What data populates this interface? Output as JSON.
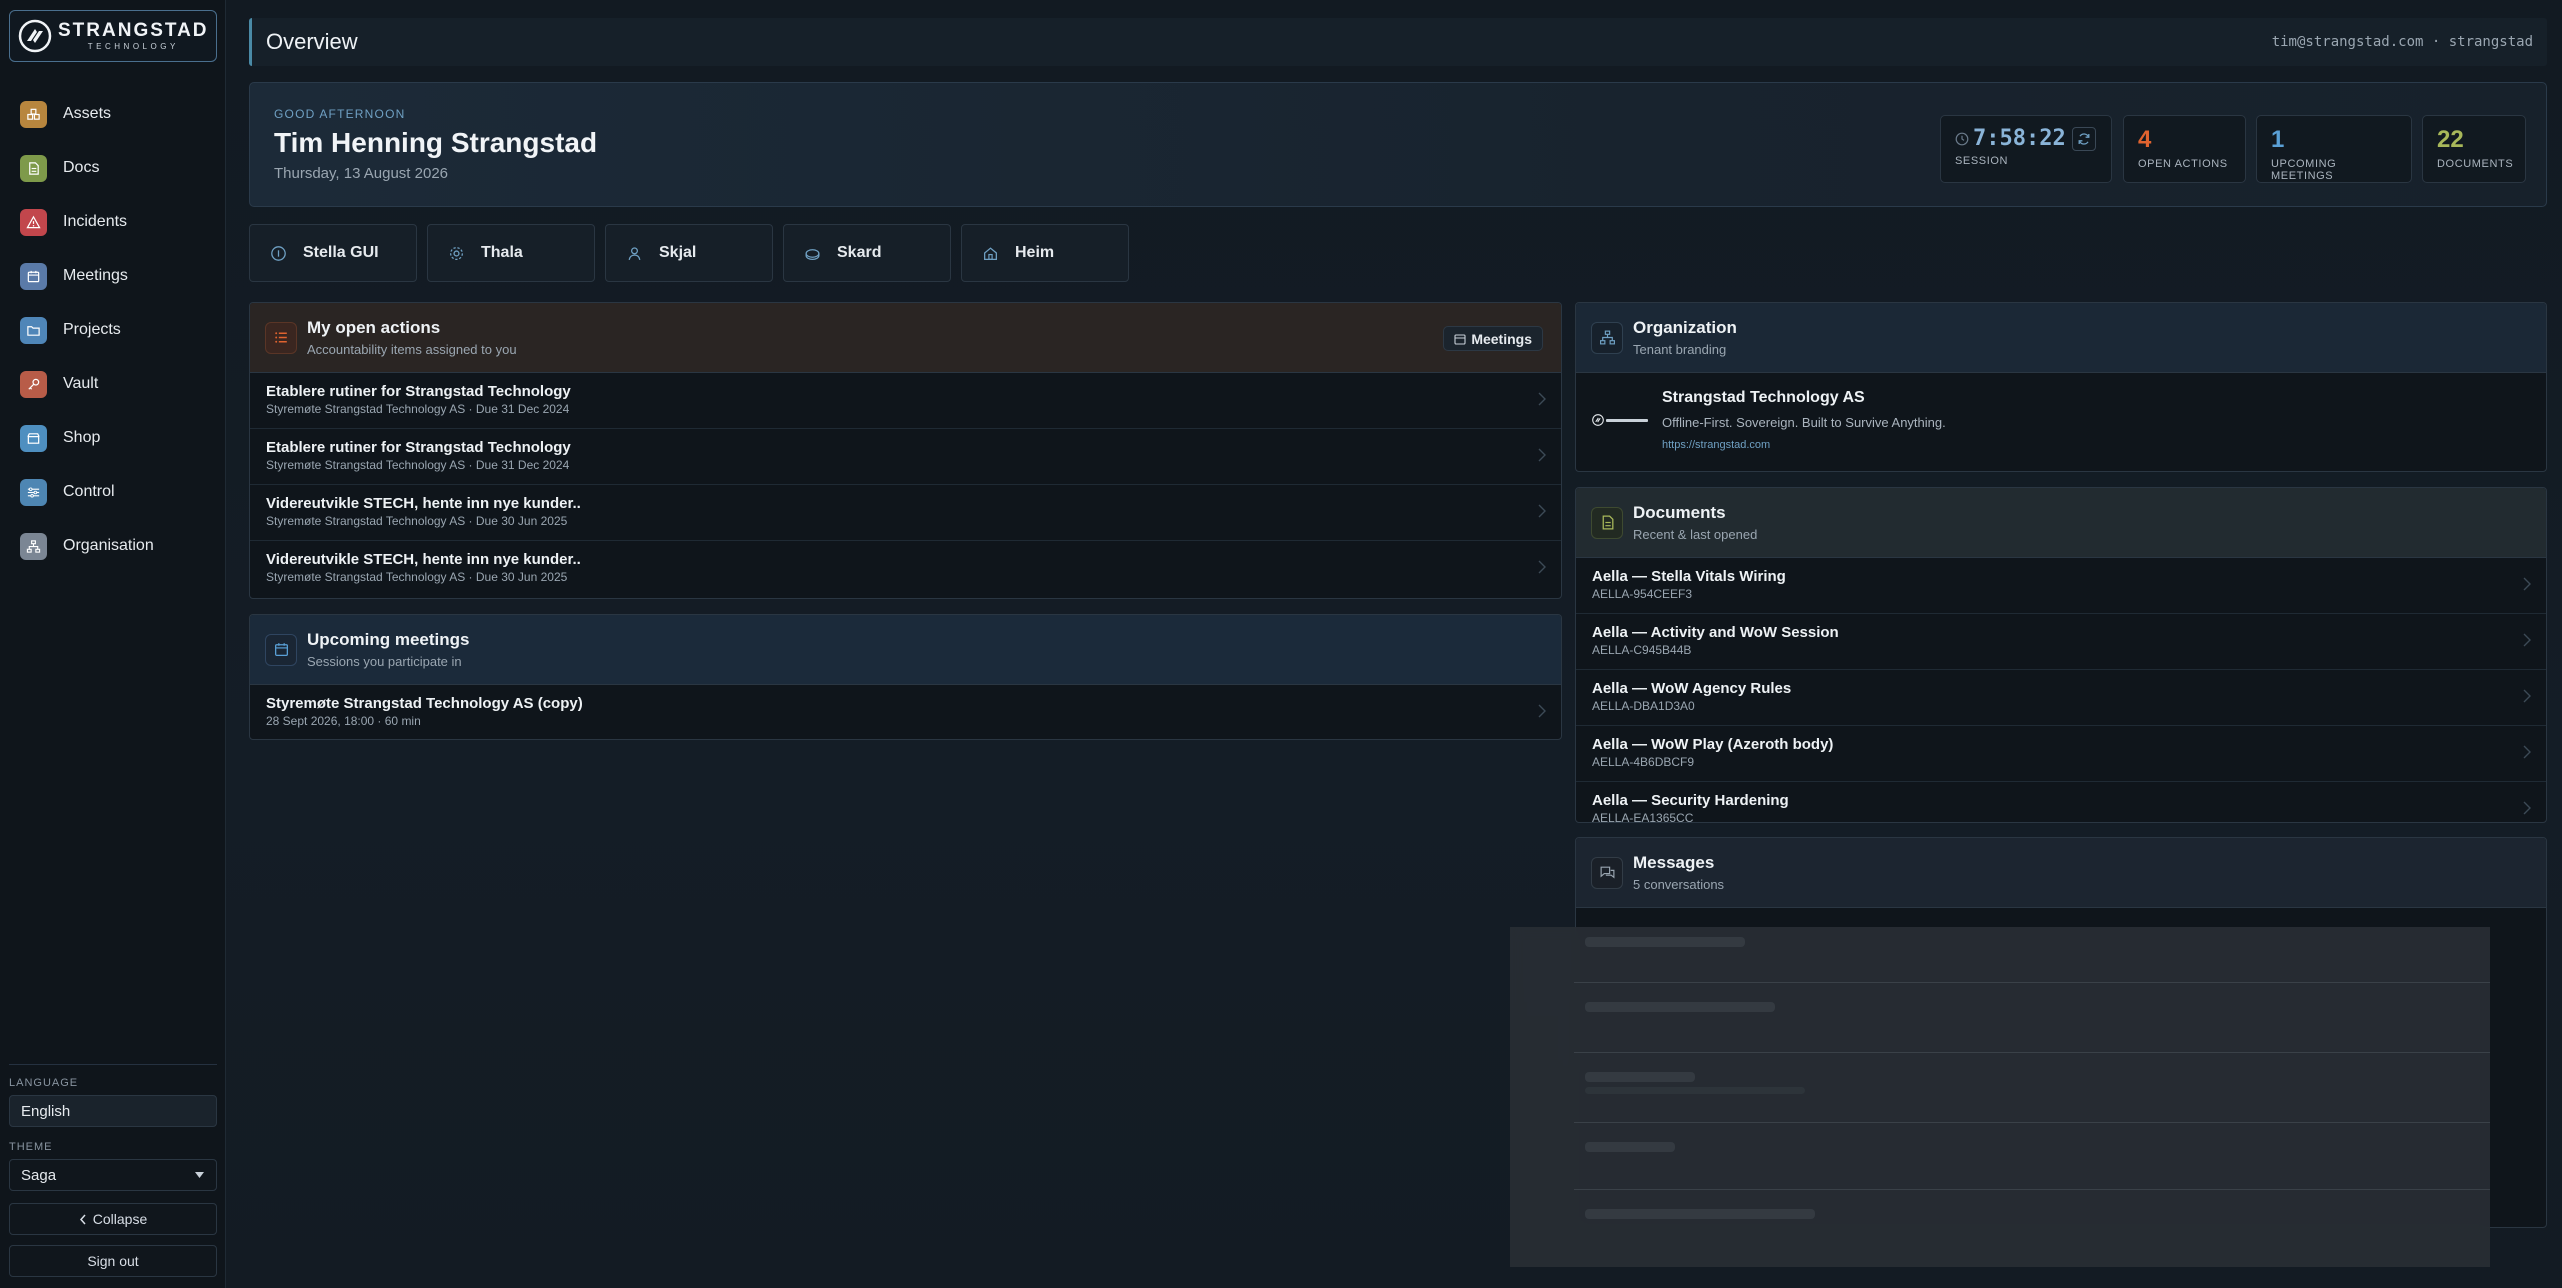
{
  "sidebar": {
    "logo": {
      "name": "STRANGSTAD",
      "sub": "TECHNOLOGY"
    },
    "items": [
      {
        "label": "Assets",
        "icon": "boxes-icon",
        "color": "#b8863e"
      },
      {
        "label": "Docs",
        "icon": "document-icon",
        "color": "#7e9a4a"
      },
      {
        "label": "Incidents",
        "icon": "warning-icon",
        "color": "#c2464c"
      },
      {
        "label": "Meetings",
        "icon": "calendar-icon",
        "color": "#5a7aa8"
      },
      {
        "label": "Projects",
        "icon": "folder-icon",
        "color": "#4f86b8"
      },
      {
        "label": "Vault",
        "icon": "key-icon",
        "color": "#b85c48"
      },
      {
        "label": "Shop",
        "icon": "shop-icon",
        "color": "#4e8fc0"
      },
      {
        "label": "Control",
        "icon": "sliders-icon",
        "color": "#4e86b3"
      },
      {
        "label": "Organisation",
        "icon": "org-icon",
        "color": "#7b8694"
      }
    ],
    "language_label": "LANGUAGE",
    "language_value": "English",
    "theme_label": "THEME",
    "theme_value": "Saga",
    "collapse_label": "Collapse",
    "signout_label": "Sign out"
  },
  "header": {
    "title": "Overview",
    "user": "tim@strangstad.com · strangstad"
  },
  "greeting": {
    "hello": "GOOD AFTERNOON",
    "name": "Tim Henning Strangstad",
    "date": "Thursday, 13 August 2026"
  },
  "stats": {
    "session_time": "7:58:22",
    "session_label": "SESSION",
    "open_actions": "4",
    "open_actions_label": "OPEN ACTIONS",
    "upcoming_meetings": "1",
    "upcoming_meetings_label": "UPCOMING MEETINGS",
    "documents": "22",
    "documents_label": "DOCUMENTS",
    "colors": {
      "actions": "#e0632f",
      "meetings": "#5aa0d6",
      "documents": "#a8b85a",
      "session": "#8ab4d8"
    }
  },
  "quick_links": [
    {
      "label": "Stella GUI",
      "icon": "info-icon"
    },
    {
      "label": "Thala",
      "icon": "gear-icon"
    },
    {
      "label": "Skjal",
      "icon": "user-icon"
    },
    {
      "label": "Skard",
      "icon": "disk-icon"
    },
    {
      "label": "Heim",
      "icon": "home-icon"
    }
  ],
  "open_actions": {
    "title": "My open actions",
    "subtitle": "Accountability items assigned to you",
    "button": "Meetings",
    "items": [
      {
        "title": "Etablere rutiner for Strangstad Technology",
        "meta": "Styremøte Strangstad Technology AS · Due 31 Dec 2024"
      },
      {
        "title": "Etablere rutiner for Strangstad Technology",
        "meta": "Styremøte Strangstad Technology AS · Due 31 Dec 2024"
      },
      {
        "title": "Videreutvikle STECH, hente inn nye kunder..",
        "meta": "Styremøte Strangstad Technology AS · Due 30 Jun 2025"
      },
      {
        "title": "Videreutvikle STECH, hente inn nye kunder..",
        "meta": "Styremøte Strangstad Technology AS · Due 30 Jun 2025"
      }
    ]
  },
  "upcoming": {
    "title": "Upcoming meetings",
    "subtitle": "Sessions you participate in",
    "items": [
      {
        "title": "Styremøte Strangstad Technology AS (copy)",
        "meta": "28 Sept 2026, 18:00 · 60 min"
      }
    ]
  },
  "organization": {
    "title": "Organization",
    "subtitle": "Tenant branding",
    "name": "Strangstad Technology AS",
    "tagline": "Offline-First. Sovereign. Built to Survive Anything.",
    "url": "https://strangstad.com"
  },
  "documents": {
    "title": "Documents",
    "subtitle": "Recent & last opened",
    "items": [
      {
        "title": "Aella — Stella Vitals Wiring",
        "id": "AELLA-954CEEF3"
      },
      {
        "title": "Aella — Activity and WoW Session",
        "id": "AELLA-C945B44B"
      },
      {
        "title": "Aella — WoW Agency Rules",
        "id": "AELLA-DBA1D3A0"
      },
      {
        "title": "Aella — WoW Play (Azeroth body)",
        "id": "AELLA-4B6DBCF9"
      },
      {
        "title": "Aella — Security Hardening",
        "id": "AELLA-EA1365CC"
      }
    ]
  },
  "messages": {
    "title": "Messages",
    "subtitle": "5 conversations"
  }
}
